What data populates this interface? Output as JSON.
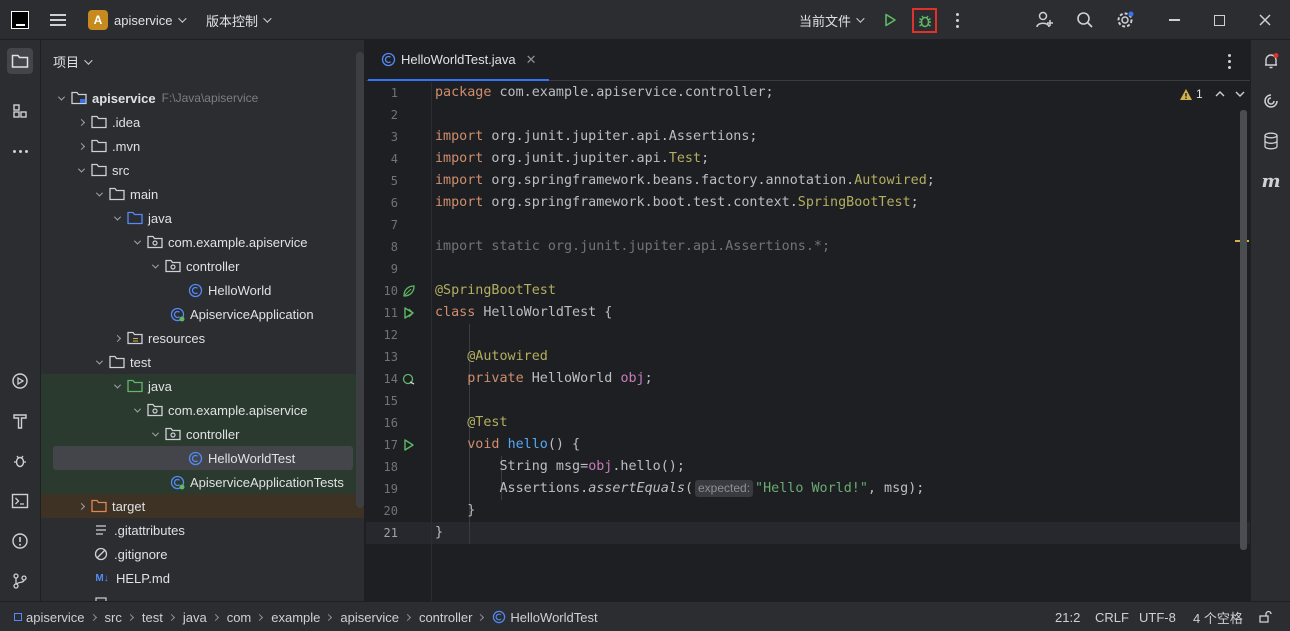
{
  "titlebar": {
    "project_badge": "A",
    "project_name": "apiservice",
    "vcs_label": "版本控制",
    "run_config": "当前文件"
  },
  "project_panel": {
    "title": "项目",
    "root_name": "apiservice",
    "root_path": "F:\\Java\\apiservice",
    "items": [
      {
        "label": ".idea"
      },
      {
        "label": ".mvn"
      },
      {
        "label": "src"
      },
      {
        "label": "main"
      },
      {
        "label": "java"
      },
      {
        "label": "com.example.apiservice"
      },
      {
        "label": "controller"
      },
      {
        "label": "HelloWorld"
      },
      {
        "label": "ApiserviceApplication"
      },
      {
        "label": "resources"
      },
      {
        "label": "test"
      },
      {
        "label": "java"
      },
      {
        "label": "com.example.apiservice"
      },
      {
        "label": "controller"
      },
      {
        "label": "HelloWorldTest"
      },
      {
        "label": "ApiserviceApplicationTests"
      },
      {
        "label": "target"
      },
      {
        "label": ".gitattributes"
      },
      {
        "label": ".gitignore"
      },
      {
        "label": "HELP.md"
      }
    ]
  },
  "editor": {
    "tab_label": "HelloWorldTest.java",
    "warning_count": "1",
    "line_numbers": [
      "1",
      "2",
      "3",
      "4",
      "5",
      "6",
      "7",
      "8",
      "9",
      "10",
      "11",
      "12",
      "13",
      "14",
      "15",
      "16",
      "17",
      "18",
      "19",
      "20",
      "21"
    ],
    "param_hint": "expected:"
  },
  "statusbar": {
    "crumbs": [
      "apiservice",
      "src",
      "test",
      "java",
      "com",
      "example",
      "apiservice",
      "controller",
      "HelloWorldTest"
    ],
    "position": "21:2",
    "line_ending": "CRLF",
    "encoding": "UTF-8",
    "indent": "4 个空格"
  },
  "icons": {
    "run": "play-icon",
    "debug": "bug-icon",
    "search": "search-icon",
    "settings": "gear-icon"
  },
  "colors": {
    "accent": "#3574f0",
    "debug_highlight": "#e0312b",
    "run_green": "#5fb865"
  }
}
